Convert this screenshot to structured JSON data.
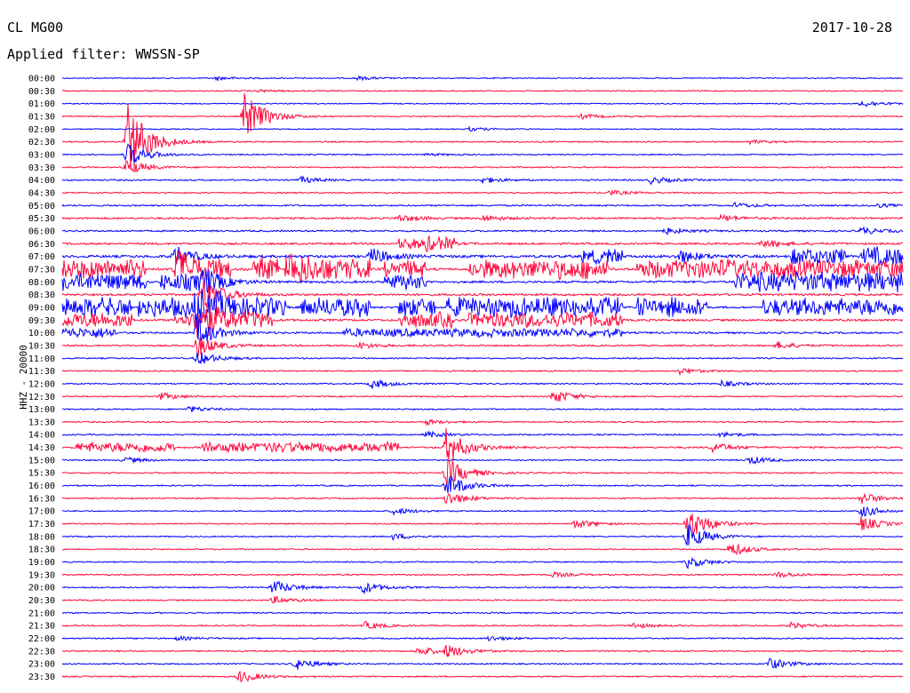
{
  "header": {
    "station": "CL MG00",
    "date": "2017-10-28",
    "filter_label": "Applied filter: WWSSN-SP",
    "channel_label": "HHZ - 20000"
  },
  "colors": {
    "even_trace": "#0000ff",
    "odd_trace": "#ff0a3c",
    "label": "#000000"
  },
  "chart_data": {
    "type": "line",
    "title": "CL MG00",
    "subtitle": "Applied filter: WWSSN-SP",
    "ylabel": "HHZ - 20000",
    "date": "2017-10-28",
    "row_interval_minutes": 30,
    "row_labels": [
      "00:00",
      "00:30",
      "01:00",
      "01:30",
      "02:00",
      "02:30",
      "03:00",
      "03:30",
      "04:00",
      "04:30",
      "05:00",
      "05:30",
      "06:00",
      "06:30",
      "07:00",
      "07:30",
      "08:00",
      "08:30",
      "09:00",
      "09:30",
      "10:00",
      "10:30",
      "11:00",
      "11:30",
      "12:00",
      "12:30",
      "13:00",
      "13:30",
      "14:00",
      "14:30",
      "15:00",
      "15:30",
      "16:00",
      "16:30",
      "17:00",
      "17:30",
      "18:00",
      "18:30",
      "19:00",
      "19:30",
      "20:00",
      "20:30",
      "21:00",
      "21:30",
      "22:00",
      "22:30",
      "23:00",
      "23:30"
    ],
    "noise_level": [
      0.8,
      0.9,
      0.8,
      0.9,
      0.8,
      1.0,
      0.9,
      1.0,
      1.1,
      1.0,
      1.2,
      1.4,
      1.3,
      1.5,
      2.0,
      1.8,
      1.6,
      1.6,
      1.5,
      1.6,
      1.4,
      1.2,
      1.0,
      1.0,
      1.0,
      1.0,
      1.0,
      1.0,
      1.1,
      1.2,
      1.0,
      1.0,
      1.0,
      1.0,
      0.9,
      0.9,
      0.9,
      0.9,
      0.9,
      1.0,
      1.0,
      1.0,
      1.0,
      1.0,
      1.0,
      1.1,
      1.0,
      1.0
    ],
    "events": [
      {
        "row": 0,
        "minute": 5.5,
        "amplitude": 3
      },
      {
        "row": 0,
        "minute": 10.5,
        "amplitude": 3
      },
      {
        "row": 1,
        "minute": 7,
        "amplitude": 2
      },
      {
        "row": 2,
        "minute": 28.5,
        "amplitude": 6
      },
      {
        "row": 3,
        "minute": 6.5,
        "amplitude": 40
      },
      {
        "row": 3,
        "minute": 18.5,
        "amplitude": 4
      },
      {
        "row": 4,
        "minute": 14.5,
        "amplitude": 3
      },
      {
        "row": 5,
        "minute": 2.3,
        "amplitude": 70
      },
      {
        "row": 5,
        "minute": 24.5,
        "amplitude": 3
      },
      {
        "row": 6,
        "minute": 2.3,
        "amplitude": 20
      },
      {
        "row": 6,
        "minute": 13,
        "amplitude": 2
      },
      {
        "row": 7,
        "minute": 2.3,
        "amplitude": 12
      },
      {
        "row": 8,
        "minute": 8.5,
        "amplitude": 5
      },
      {
        "row": 8,
        "minute": 15,
        "amplitude": 5
      },
      {
        "row": 8,
        "minute": 21,
        "amplitude": 6
      },
      {
        "row": 9,
        "minute": 19.5,
        "amplitude": 4
      },
      {
        "row": 10,
        "minute": 24,
        "amplitude": 4
      },
      {
        "row": 10,
        "minute": 29,
        "amplitude": 3
      },
      {
        "row": 11,
        "minute": 12,
        "amplitude": 6
      },
      {
        "row": 11,
        "minute": 15,
        "amplitude": 5
      },
      {
        "row": 11,
        "minute": 23.5,
        "amplitude": 5
      },
      {
        "row": 12,
        "minute": 21.5,
        "amplitude": 5
      },
      {
        "row": 12,
        "minute": 28.5,
        "amplitude": 6
      },
      {
        "row": 13,
        "minute": 13,
        "amplitude": 6
      },
      {
        "row": 13,
        "minute": 25,
        "amplitude": 7
      },
      {
        "row": 14,
        "minute": 4,
        "amplitude": 18
      },
      {
        "row": 14,
        "minute": 11,
        "amplitude": 14
      },
      {
        "row": 14,
        "minute": 22,
        "amplitude": 12
      },
      {
        "row": 15,
        "minute": 4,
        "amplitude": 25
      },
      {
        "row": 15,
        "minute": 8,
        "amplitude": 22
      },
      {
        "row": 16,
        "minute": 5,
        "amplitude": 28
      },
      {
        "row": 17,
        "minute": 5,
        "amplitude": 30
      },
      {
        "row": 18,
        "minute": 4.8,
        "amplitude": 40
      },
      {
        "row": 19,
        "minute": 4.8,
        "amplitude": 30
      },
      {
        "row": 20,
        "minute": 4.8,
        "amplitude": 25
      },
      {
        "row": 21,
        "minute": 4.8,
        "amplitude": 18
      },
      {
        "row": 21,
        "minute": 10.5,
        "amplitude": 6
      },
      {
        "row": 21,
        "minute": 25.5,
        "amplitude": 6
      },
      {
        "row": 22,
        "minute": 4.8,
        "amplitude": 12
      },
      {
        "row": 23,
        "minute": 22,
        "amplitude": 5
      },
      {
        "row": 24,
        "minute": 11,
        "amplitude": 8
      },
      {
        "row": 24,
        "minute": 23.5,
        "amplitude": 5
      },
      {
        "row": 25,
        "minute": 3.5,
        "amplitude": 6
      },
      {
        "row": 25,
        "minute": 17.5,
        "amplitude": 12
      },
      {
        "row": 26,
        "minute": 4.5,
        "amplitude": 5
      },
      {
        "row": 27,
        "minute": 13,
        "amplitude": 4
      },
      {
        "row": 28,
        "minute": 13,
        "amplitude": 5
      },
      {
        "row": 28,
        "minute": 23.5,
        "amplitude": 4
      },
      {
        "row": 29,
        "minute": 13.7,
        "amplitude": 30
      },
      {
        "row": 29,
        "minute": 23.2,
        "amplitude": 8
      },
      {
        "row": 30,
        "minute": 2.2,
        "amplitude": 5
      },
      {
        "row": 30,
        "minute": 24.5,
        "amplitude": 7
      },
      {
        "row": 31,
        "minute": 13.7,
        "amplitude": 25
      },
      {
        "row": 32,
        "minute": 13.7,
        "amplitude": 20
      },
      {
        "row": 33,
        "minute": 13.7,
        "amplitude": 12
      },
      {
        "row": 33,
        "minute": 28.5,
        "amplitude": 10
      },
      {
        "row": 34,
        "minute": 11.8,
        "amplitude": 6
      },
      {
        "row": 34,
        "minute": 28.5,
        "amplitude": 10
      },
      {
        "row": 35,
        "minute": 18.3,
        "amplitude": 8
      },
      {
        "row": 35,
        "minute": 22.3,
        "amplitude": 30
      },
      {
        "row": 35,
        "minute": 28.5,
        "amplitude": 12
      },
      {
        "row": 36,
        "minute": 11.8,
        "amplitude": 5
      },
      {
        "row": 36,
        "minute": 22.3,
        "amplitude": 22
      },
      {
        "row": 37,
        "minute": 23.8,
        "amplitude": 12
      },
      {
        "row": 38,
        "minute": 22.3,
        "amplitude": 10
      },
      {
        "row": 39,
        "minute": 17.5,
        "amplitude": 4
      },
      {
        "row": 39,
        "minute": 25.5,
        "amplitude": 5
      },
      {
        "row": 40,
        "minute": 7.5,
        "amplitude": 12
      },
      {
        "row": 40,
        "minute": 10.7,
        "amplitude": 10
      },
      {
        "row": 41,
        "minute": 7.5,
        "amplitude": 6
      },
      {
        "row": 43,
        "minute": 10.8,
        "amplitude": 6
      },
      {
        "row": 43,
        "minute": 20.3,
        "amplitude": 5
      },
      {
        "row": 43,
        "minute": 26,
        "amplitude": 5
      },
      {
        "row": 44,
        "minute": 4.1,
        "amplitude": 3
      },
      {
        "row": 44,
        "minute": 15.2,
        "amplitude": 4
      },
      {
        "row": 45,
        "minute": 12.7,
        "amplitude": 8
      },
      {
        "row": 45,
        "minute": 13.7,
        "amplitude": 10
      },
      {
        "row": 46,
        "minute": 8.3,
        "amplitude": 10
      },
      {
        "row": 46,
        "minute": 25.2,
        "amplitude": 10
      },
      {
        "row": 47,
        "minute": 6.3,
        "amplitude": 10
      }
    ],
    "noisy_bursts": [
      {
        "row": 13,
        "start": 12,
        "end": 14,
        "amplitude": 8
      },
      {
        "row": 14,
        "start": 18.5,
        "end": 20,
        "amplitude": 10
      },
      {
        "row": 14,
        "start": 26,
        "end": 28,
        "amplitude": 14
      },
      {
        "row": 14,
        "start": 28.5,
        "end": 30,
        "amplitude": 15
      },
      {
        "row": 15,
        "start": 0,
        "end": 3,
        "amplitude": 16
      },
      {
        "row": 15,
        "start": 4,
        "end": 6,
        "amplitude": 14
      },
      {
        "row": 15,
        "start": 6.8,
        "end": 7.8,
        "amplitude": 18
      },
      {
        "row": 15,
        "start": 8,
        "end": 11,
        "amplitude": 16
      },
      {
        "row": 15,
        "start": 11.5,
        "end": 13,
        "amplitude": 14
      },
      {
        "row": 15,
        "start": 14.5,
        "end": 16.5,
        "amplitude": 15
      },
      {
        "row": 15,
        "start": 16.5,
        "end": 19.5,
        "amplitude": 16
      },
      {
        "row": 15,
        "start": 20.5,
        "end": 22.5,
        "amplitude": 15
      },
      {
        "row": 15,
        "start": 22.5,
        "end": 24,
        "amplitude": 16
      },
      {
        "row": 15,
        "start": 24,
        "end": 30,
        "amplitude": 14
      },
      {
        "row": 16,
        "start": 0,
        "end": 3,
        "amplitude": 14
      },
      {
        "row": 16,
        "start": 3.5,
        "end": 5,
        "amplitude": 14
      },
      {
        "row": 16,
        "start": 11.5,
        "end": 13,
        "amplitude": 12
      },
      {
        "row": 16,
        "start": 24,
        "end": 30,
        "amplitude": 16
      },
      {
        "row": 18,
        "start": 0,
        "end": 2.5,
        "amplitude": 16
      },
      {
        "row": 18,
        "start": 2.7,
        "end": 4.8,
        "amplitude": 16
      },
      {
        "row": 18,
        "start": 5.5,
        "end": 8,
        "amplitude": 16
      },
      {
        "row": 18,
        "start": 8.5,
        "end": 11,
        "amplitude": 16
      },
      {
        "row": 18,
        "start": 12,
        "end": 13.3,
        "amplitude": 16
      },
      {
        "row": 18,
        "start": 13.7,
        "end": 20,
        "amplitude": 16
      },
      {
        "row": 18,
        "start": 20.5,
        "end": 23,
        "amplitude": 16
      },
      {
        "row": 18,
        "start": 25,
        "end": 30,
        "amplitude": 14
      },
      {
        "row": 19,
        "start": 0,
        "end": 2.5,
        "amplitude": 12
      },
      {
        "row": 19,
        "start": 4,
        "end": 7.5,
        "amplitude": 12
      },
      {
        "row": 19,
        "start": 12,
        "end": 14,
        "amplitude": 12
      },
      {
        "row": 19,
        "start": 14.5,
        "end": 20,
        "amplitude": 12
      },
      {
        "row": 20,
        "start": 0,
        "end": 2,
        "amplitude": 8
      },
      {
        "row": 20,
        "start": 10,
        "end": 20,
        "amplitude": 6
      },
      {
        "row": 29,
        "start": 0.5,
        "end": 4,
        "amplitude": 8
      },
      {
        "row": 29,
        "start": 5,
        "end": 12,
        "amplitude": 8
      }
    ]
  }
}
